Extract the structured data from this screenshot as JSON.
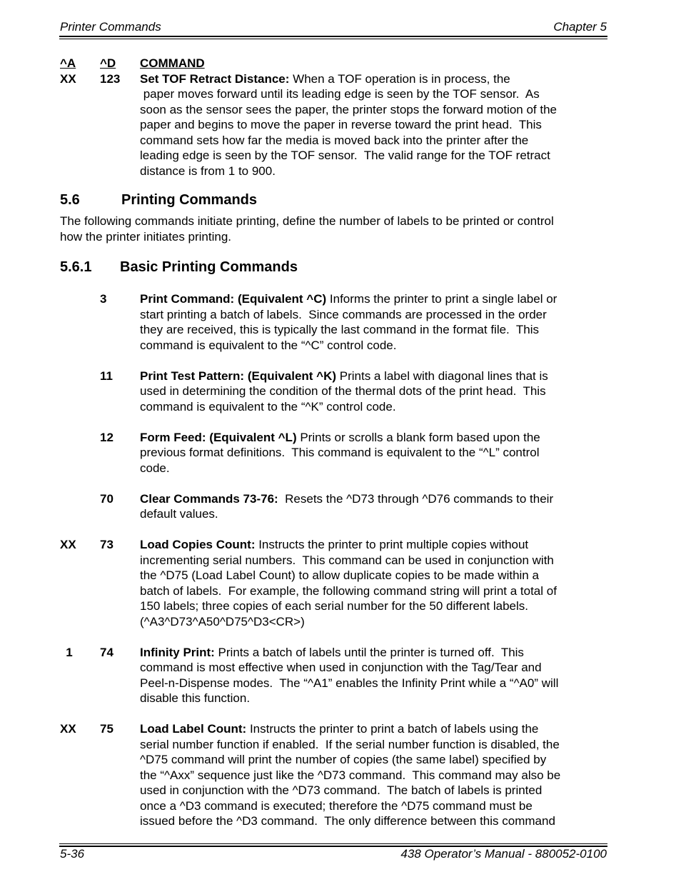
{
  "header": {
    "left": "Printer Commands",
    "right": "Chapter 5"
  },
  "footer": {
    "left": "5-36",
    "right": "438 Operator’s Manual - 880052-0100"
  },
  "column_headers": {
    "a": "^A",
    "d": "^D",
    "command": "COMMAND"
  },
  "top_command": {
    "a": "XX",
    "d": "123",
    "title": "Set TOF Retract Distance:",
    "lines": [
      " When a TOF operation is in process, the",
      " paper moves forward until its leading edge is seen by the TOF sensor.  As",
      "soon as the sensor sees the paper, the printer stops the forward motion of the",
      "paper and begins to move the paper in reverse toward the print head.  This",
      "command sets how far the media is moved back into the printer after the",
      "leading edge is seen by the TOF sensor.  The valid range for the TOF retract",
      "distance is from 1 to 900."
    ]
  },
  "section": {
    "number": "5.6",
    "title": "Printing Commands",
    "intro_lines": [
      "The following commands initiate printing, define the number of labels to be printed or control",
      "how the printer initiates printing."
    ]
  },
  "subsection": {
    "number": "5.6.1",
    "title": "Basic Printing Commands"
  },
  "commands": [
    {
      "a": "",
      "d": "3",
      "title": "Print Command: (Equivalent ^C)",
      "lines": [
        " Informs the printer to print a single label or",
        "start printing a batch of labels.  Since commands are processed in the order",
        "they are received, this is typically the last command in the format file.  This",
        "command is equivalent to the “^C” control code."
      ]
    },
    {
      "a": "",
      "d": "11",
      "title": "Print Test Pattern: (Equivalent ^K)",
      "lines": [
        " Prints a label with diagonal lines that is",
        "used in determining the condition of the thermal dots of the print head.  This",
        "command is equivalent to the “^K” control code."
      ]
    },
    {
      "a": "",
      "d": "12",
      "title": "Form Feed: (Equivalent ^L)",
      "lines": [
        " Prints or scrolls a blank form based upon the",
        "previous format definitions.  This command is equivalent to the “^L” control",
        "code."
      ]
    },
    {
      "a": "",
      "d": "70",
      "title": "Clear Commands 73-76:",
      "lines": [
        "  Resets the ^D73 through ^D76 commands to their",
        "default values."
      ]
    },
    {
      "a": "XX",
      "d": "73",
      "title": "Load Copies Count:",
      "lines": [
        " Instructs the printer to print multiple copies without",
        "incrementing serial numbers.  This command can be used in conjunction with",
        "the ^D75 (Load Label Count) to allow duplicate copies to be made within a",
        "batch of labels.  For example, the following command string will print a total of",
        "150 labels; three copies of each serial number for the 50 different labels.",
        "(^A3^D73^A50^D75^D3<CR>)"
      ]
    },
    {
      "a": "1",
      "d": "74",
      "title": "Infinity Print:",
      "lines": [
        " Prints a batch of labels until the printer is turned off.  This",
        "command is most effective when used in conjunction with the Tag/Tear and",
        "Peel-n-Dispense modes.  The “^A1” enables the Infinity Print while a “^A0” will",
        "disable this function."
      ]
    },
    {
      "a": "XX",
      "d": "75",
      "title": "Load Label Count:",
      "lines": [
        " Instructs the printer to print a batch of labels using the",
        "serial number function if enabled.  If the serial number function is disabled, the",
        "^D75 command will print the number of copies (the same label) specified by",
        "the “^Axx” sequence just like the ^D73 command.  This command may also be",
        "used in conjunction with the ^D73 command.  The batch of labels is printed",
        "once a ^D3 command is executed; therefore the ^D75 command must be",
        "issued before the ^D3 command.  The only difference between this command"
      ]
    }
  ]
}
